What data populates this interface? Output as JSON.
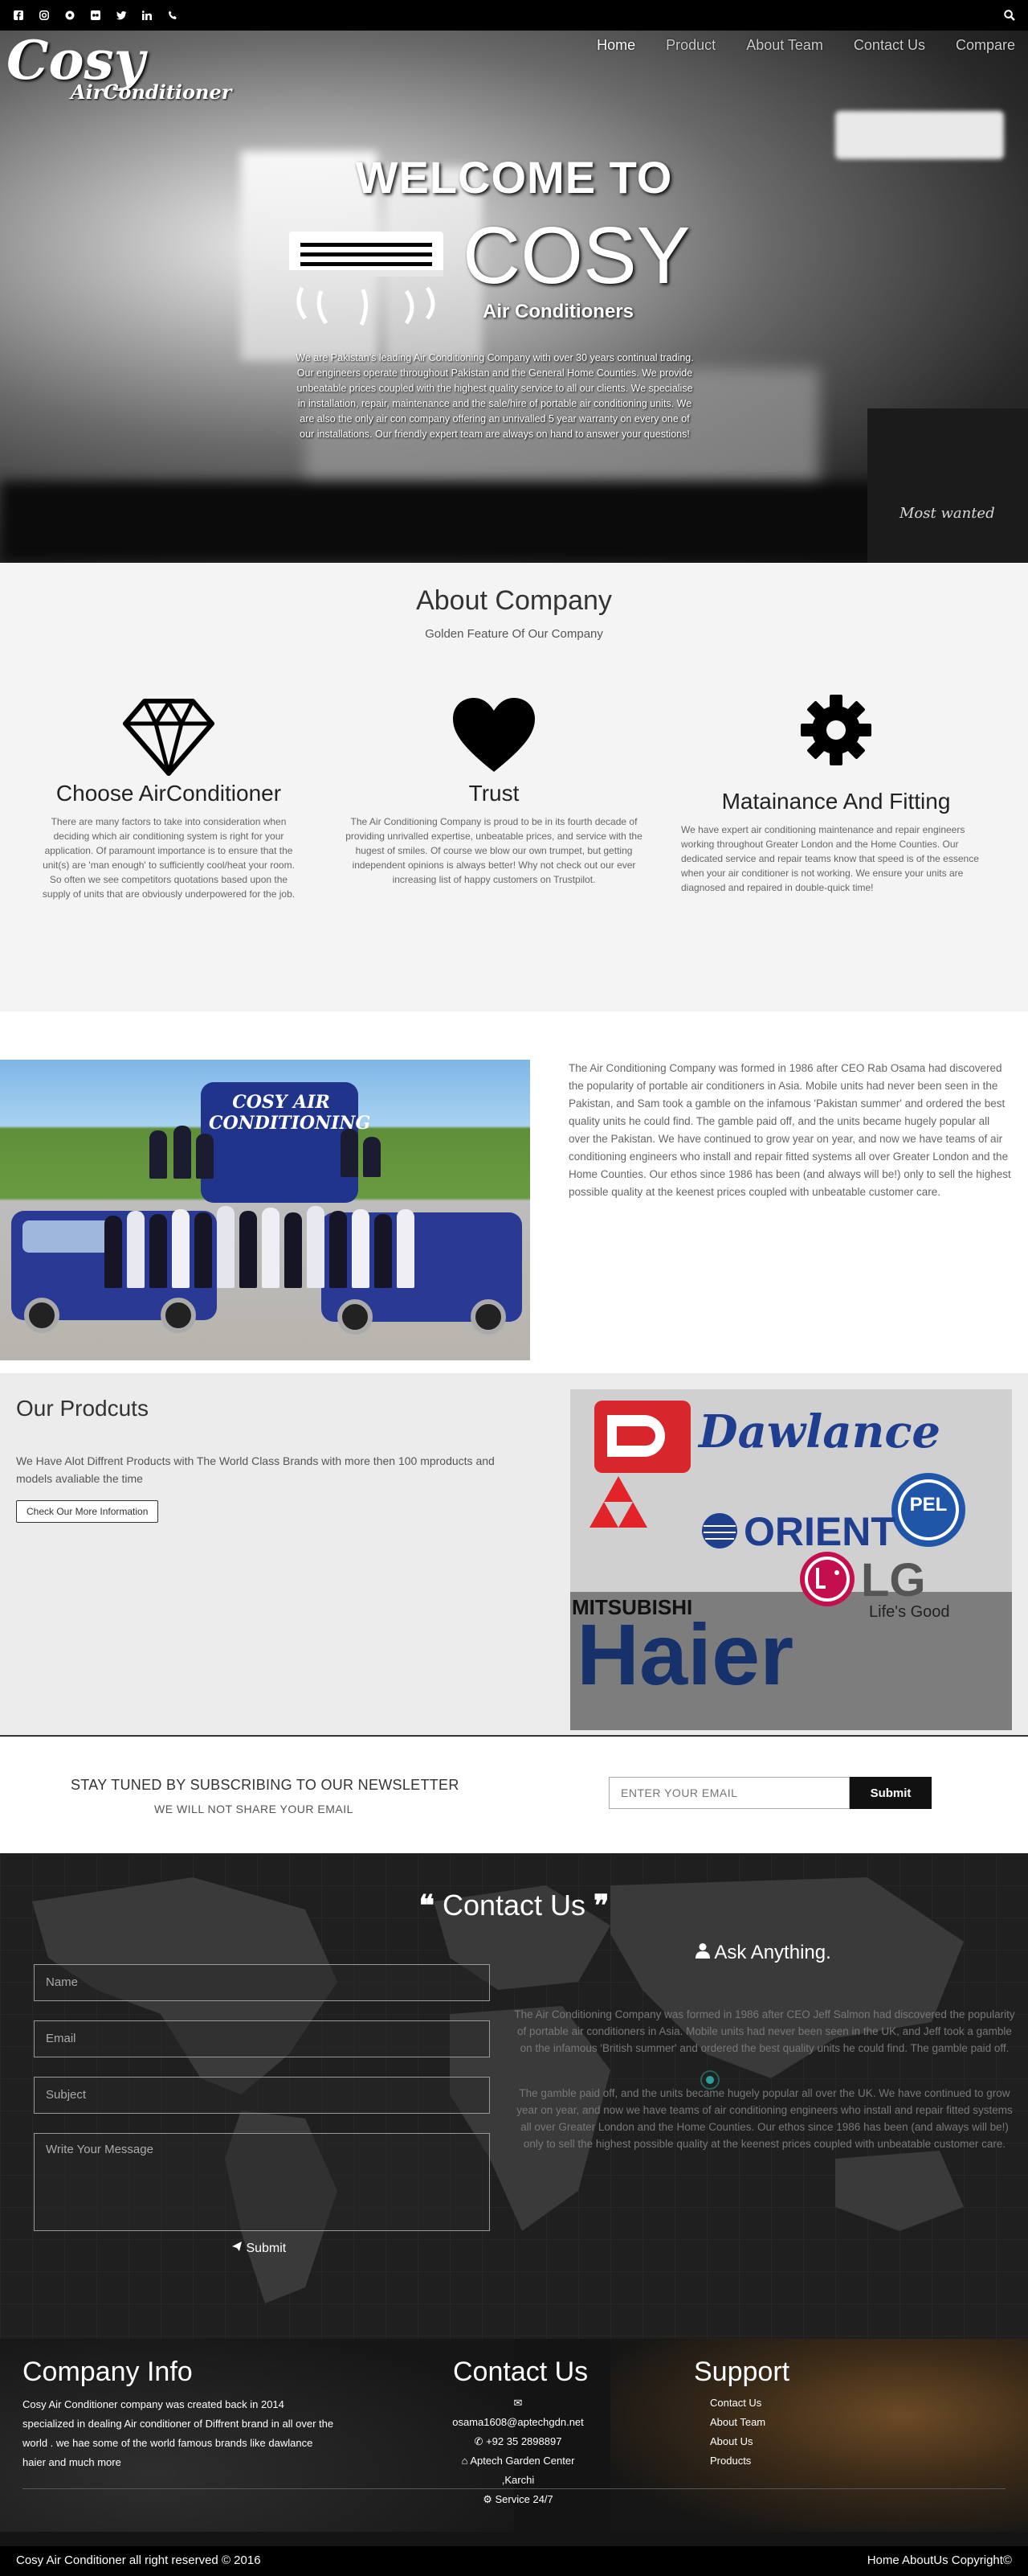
{
  "topbar": {
    "social_icons": [
      "facebook-icon",
      "instagram-icon",
      "circle-icon",
      "flickr-icon",
      "twitter-icon",
      "linkedin-icon",
      "phone-icon"
    ],
    "search_icon": "search-icon"
  },
  "logo": {
    "line1": "Cosy",
    "line2": "AirConditioner"
  },
  "nav": {
    "items": [
      "Home",
      "Product",
      "About Team",
      "Contact Us",
      "Compare"
    ],
    "active": "Home"
  },
  "hero": {
    "welcome": "WELCOME TO",
    "brand": "COSY",
    "brand_tag": "Air Conditioners",
    "text": "We are Pakistan's leading Air Conditioning Company with over 30 years continual trading. Our engineers operate throughout Pakistan and the General Home Counties. We provide unbeatable prices coupled with the highest quality service to all our clients. We specialise in installation, repair, maintenance and the sale/hire of portable air conditioning units. We are also the only air con company offering an unrivalled 5 year warranty on every one of our installations. Our friendly expert team are always on hand to answer your questions!",
    "bg_text": "Most wanted"
  },
  "about": {
    "title": "About Company",
    "subtitle": "Golden Feature Of Our Company",
    "features": [
      {
        "icon": "diamond-icon",
        "title": "Choose AirConditioner",
        "text": "There are many factors to take into consideration when deciding which air conditioning system is right for your application. Of paramount importance is to ensure that the unit(s) are 'man enough' to sufficiently cool/heat your room. So often we see competitors quotations based upon the supply of units that are obviously underpowered for the job."
      },
      {
        "icon": "heart-icon",
        "title": "Trust",
        "text": "The Air Conditioning Company is proud to be in its fourth decade of providing unrivalled expertise, unbeatable prices, and service with the hugest of smiles. Of course we blow our own trumpet, but getting independent opinions is always better! Why not check out our ever increasing list of happy customers on Trustpilot."
      },
      {
        "icon": "gear-icon",
        "title": "Matainance And Fitting",
        "text": "We have expert air conditioning maintenance and repair engineers working throughout Greater London and the Home Counties. Our dedicated service and repair teams know that speed is of the essence when your air conditioner is not working. We ensure your units are diagnosed and repaired in double-quick time!"
      }
    ]
  },
  "story": {
    "text": "The Air Conditioning Company was formed in 1986 after CEO Rab Osama had discovered the popularity of portable air conditioners in Asia. Mobile units had never been seen in the Pakistan, and Sam took a gamble on the infamous 'Pakistan summer' and ordered the best quality units he could find. The gamble paid off, and the units became hugely popular all over the Pakistan. We have continued to grow year on year, and now we have teams of air conditioning engineers who install and repair fitted systems all over Greater London and the Home Counties. Our ethos since 1986 has been (and always will be!) only to sell the highest possible quality at the keenest prices coupled with unbeatable customer care.",
    "photo_van_text": "COSY AIR CONDITIONING"
  },
  "products": {
    "title": "Our Prodcuts",
    "text": "We Have Alot Diffrent Products with The World Class Brands with more then 100 mproducts and models avaliable the time",
    "button": "Check Our More Information",
    "brands": {
      "dawlance": "Dawlance",
      "pel": "PEL",
      "orient": "ORIENT",
      "mitsubishi": "MITSUBISHI",
      "lg": "LG",
      "lg_tag": "Life's Good",
      "haier": "Haier"
    }
  },
  "newsletter": {
    "title": "STAY TUNED BY SUBSCRIBING TO OUR NEWSLETTER",
    "subtitle": "WE WILL NOT SHARE YOUR EMAIL",
    "placeholder": "ENTER YOUR EMAIL",
    "button": "Submit"
  },
  "contact": {
    "title": "Contact Us",
    "fields": {
      "name": "Name",
      "email": "Email",
      "subject": "Subject",
      "message": "Write Your Message"
    },
    "submit": "Submit",
    "ask_title": "Ask Anything.",
    "para1": "The Air Conditioning Company was formed in 1986 after CEO Jeff Salmon had discovered the popularity of portable air conditioners in Asia. Mobile units had never been seen in the UK, and Jeff took a gamble on the infamous 'British summer' and ordered the best quality units he could find. The gamble paid off.",
    "para2": "The gamble paid off, and the units became hugely popular all over the UK. We have continued to grow year on year, and now we have teams of air conditioning engineers who install and repair fitted systems all over Greater London and the Home Counties. Our ethos since 1986 has been (and always will be!) only to sell the highest possible quality at the keenest prices coupled with unbeatable customer care."
  },
  "footer": {
    "company_title": "Company Info",
    "company_text": "Cosy Air Conditioner company was created back in 2014 specialized in dealing Air conditioner of Diffrent brand in all over the world . we hae some of the world famous brands like dawlance haier and much more",
    "contact_title": "Contact Us",
    "email": "osama1608@aptechgdn.net",
    "phone": "+92 35 2898897",
    "address": "Aptech Garden Center ,Karchi",
    "service": "Service 24/7",
    "support_title": "Support",
    "support_links": [
      "Contact Us",
      "About Team",
      "About Us",
      "Products"
    ],
    "copyright": "Cosy Air Conditioner all right reserved © 2016",
    "bottom_links": "Home AboutUs Copyright©"
  },
  "colors": {
    "topbar": "#000000",
    "about_bg": "#f4f4f4",
    "products_bg": "#ececec",
    "contact_bg": "#1f1f1f",
    "dawlance_red": "#d7262c",
    "dawlance_blue": "#1f3e8f",
    "haier_blue": "#17326b"
  }
}
